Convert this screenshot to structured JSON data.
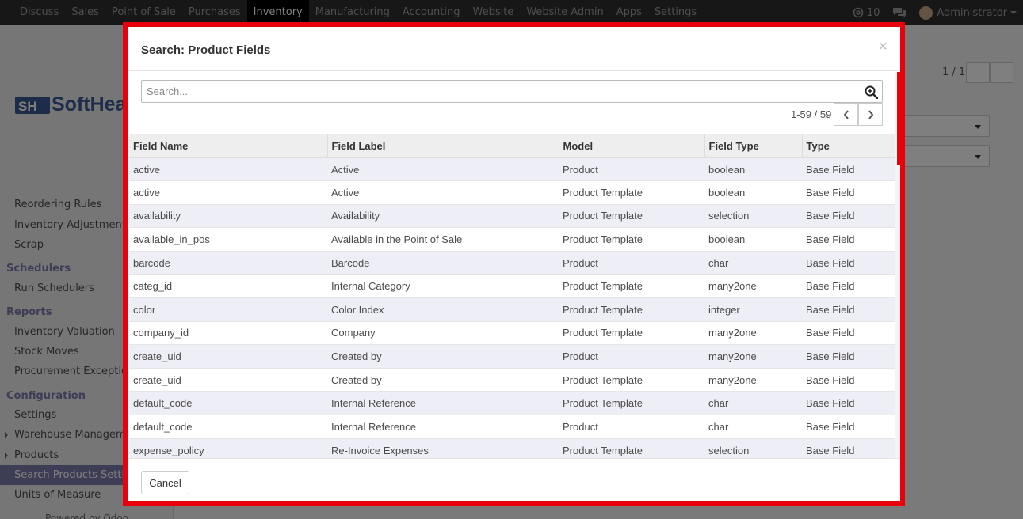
{
  "topbar": {
    "menu": [
      "Discuss",
      "Sales",
      "Point of Sale",
      "Purchases",
      "Inventory",
      "Manufacturing",
      "Accounting",
      "Website",
      "Website Admin",
      "Apps",
      "Settings"
    ],
    "active_menu": "Inventory",
    "notification_count": "10",
    "user": "Administrator"
  },
  "sidebar": {
    "logo_text": "SoftHea",
    "links_top": [
      "Reordering Rules",
      "Inventory Adjustments",
      "Scrap"
    ],
    "section_schedulers": "Schedulers",
    "link_run_schedulers": "Run Schedulers",
    "section_reports": "Reports",
    "links_reports": [
      "Inventory Valuation",
      "Stock Moves",
      "Procurement Exceptions"
    ],
    "section_configuration": "Configuration",
    "link_settings": "Settings",
    "link_warehouse": "Warehouse Management",
    "link_products": "Products",
    "link_search_products": "Search Products Settings",
    "link_uom": "Units of Measure",
    "powered_by": "Powered by Odoo"
  },
  "background": {
    "pager": "1 / 1"
  },
  "modal": {
    "title": "Search: Product Fields",
    "close_symbol": "×",
    "search_placeholder": "Search...",
    "pager": "1-59 / 59",
    "columns": [
      "Field Name",
      "Field Label",
      "Model",
      "Field Type",
      "Type"
    ],
    "rows": [
      [
        "active",
        "Active",
        "Product",
        "boolean",
        "Base Field"
      ],
      [
        "active",
        "Active",
        "Product Template",
        "boolean",
        "Base Field"
      ],
      [
        "availability",
        "Availability",
        "Product Template",
        "selection",
        "Base Field"
      ],
      [
        "available_in_pos",
        "Available in the Point of Sale",
        "Product Template",
        "boolean",
        "Base Field"
      ],
      [
        "barcode",
        "Barcode",
        "Product",
        "char",
        "Base Field"
      ],
      [
        "categ_id",
        "Internal Category",
        "Product Template",
        "many2one",
        "Base Field"
      ],
      [
        "color",
        "Color Index",
        "Product Template",
        "integer",
        "Base Field"
      ],
      [
        "company_id",
        "Company",
        "Product Template",
        "many2one",
        "Base Field"
      ],
      [
        "create_uid",
        "Created by",
        "Product",
        "many2one",
        "Base Field"
      ],
      [
        "create_uid",
        "Created by",
        "Product Template",
        "many2one",
        "Base Field"
      ],
      [
        "default_code",
        "Internal Reference",
        "Product Template",
        "char",
        "Base Field"
      ],
      [
        "default_code",
        "Internal Reference",
        "Product",
        "char",
        "Base Field"
      ],
      [
        "expense_policy",
        "Re-Invoice Expenses",
        "Product Template",
        "selection",
        "Base Field"
      ]
    ],
    "cancel_label": "Cancel"
  },
  "colors": {
    "highlight_border": "#e8000b",
    "section_accent": "#7c7bad",
    "navbar": "#2f2f2f"
  }
}
